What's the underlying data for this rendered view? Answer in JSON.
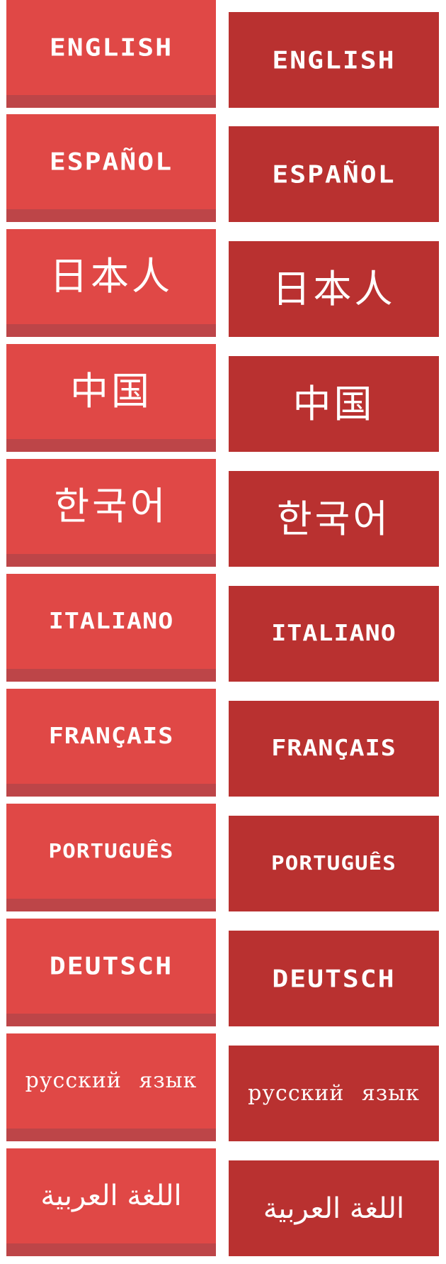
{
  "colors": {
    "button_normal": "#e04846",
    "button_normal_shadow": "#bd4548",
    "button_pressed": "#b93130",
    "text": "#ffffff",
    "background": "#ffffff"
  },
  "languages": [
    {
      "id": "english",
      "label": "ENGLISH"
    },
    {
      "id": "espanol",
      "label": "ESPAÑOL"
    },
    {
      "id": "japanese",
      "label": "日本人"
    },
    {
      "id": "chinese",
      "label": "中国"
    },
    {
      "id": "korean",
      "label": "한국어"
    },
    {
      "id": "italiano",
      "label": "ITALIANO"
    },
    {
      "id": "francais",
      "label": "FRANÇAIS"
    },
    {
      "id": "portugues",
      "label": "PORTUGUÊS"
    },
    {
      "id": "deutsch",
      "label": "DEUTSCH"
    },
    {
      "id": "russian",
      "label": "русский язык"
    },
    {
      "id": "arabic",
      "label": "اللغة العربية"
    }
  ],
  "button_states": {
    "normal": "normal",
    "pressed": "pressed"
  }
}
